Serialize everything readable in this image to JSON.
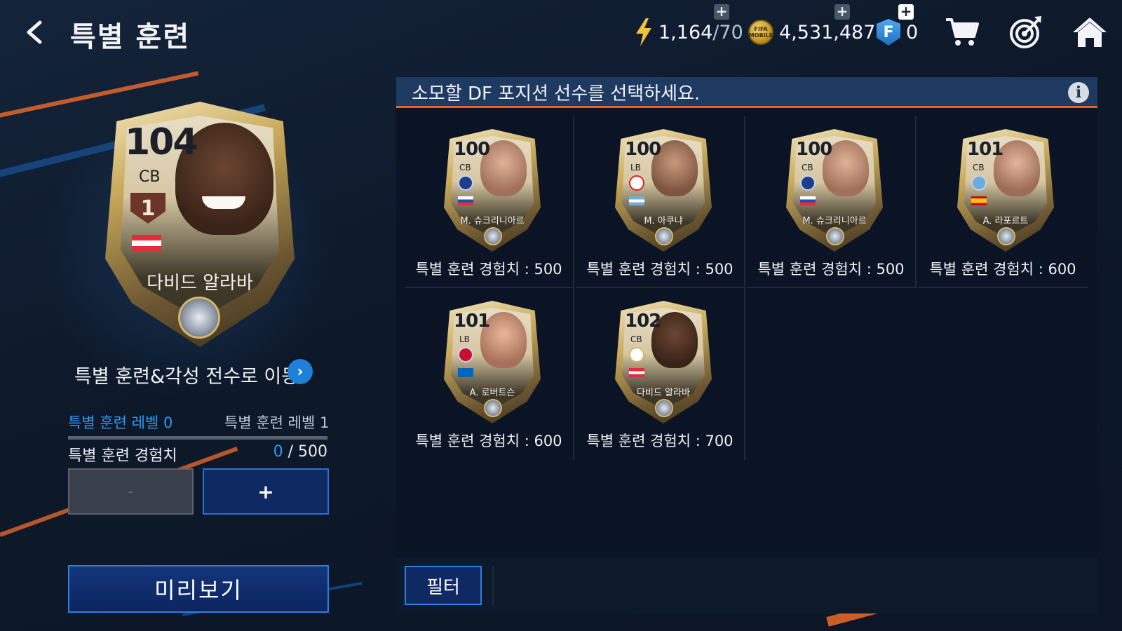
{
  "header": {
    "title": "특별 훈련",
    "energy": {
      "value": "1,164",
      "max": "/70"
    },
    "coins": "4,531,487",
    "coin_icon_label": "FIFA MOBILE",
    "fifa_points": "0",
    "fp_icon_label": "F",
    "icons": [
      "back-icon",
      "cart-icon",
      "target-icon",
      "home-icon"
    ]
  },
  "selected_player": {
    "ovr": "104",
    "position": "CB",
    "rank": "1",
    "name": "다비드 알라바"
  },
  "left_panel": {
    "goto_text": "특별 훈련&각성 전수로 이동",
    "goto_arrow": "›",
    "level_current": "특별 훈련 레벨 0",
    "level_next": "특별 훈련 레벨 1",
    "xp_label": "특별 훈련 경험치",
    "xp_current": "0",
    "xp_total": " / 500",
    "minus_label": "-",
    "plus_label": "+",
    "preview_label": "미리보기"
  },
  "right_panel": {
    "instruction": "소모할 DF 포지션 선수를 선택하세요.",
    "info_label": "i",
    "filter_label": "필터",
    "cards": [
      {
        "ovr": "100",
        "position": "CB",
        "name": "M. 슈크리니아르",
        "xp": "특별 훈련 경험치 : 500"
      },
      {
        "ovr": "100",
        "position": "LB",
        "name": "M. 아쿠냐",
        "xp": "특별 훈련 경험치 : 500"
      },
      {
        "ovr": "100",
        "position": "CB",
        "name": "M. 슈크리니아르",
        "xp": "특별 훈련 경험치 : 500"
      },
      {
        "ovr": "101",
        "position": "CB",
        "name": "A. 라포르트",
        "xp": "특별 훈련 경험치 : 600"
      },
      {
        "ovr": "101",
        "position": "LB",
        "name": "A. 로버트슨",
        "xp": "특별 훈련 경험치 : 600"
      },
      {
        "ovr": "102",
        "position": "CB",
        "name": "다비드 알라바",
        "xp": "특별 훈련 경험치 : 700"
      }
    ]
  },
  "colors": {
    "accent_blue": "#2e9bf0",
    "accent_orange": "#e2662b",
    "button_blue": "#0f2a63",
    "panel_header": "#1f3a60"
  }
}
